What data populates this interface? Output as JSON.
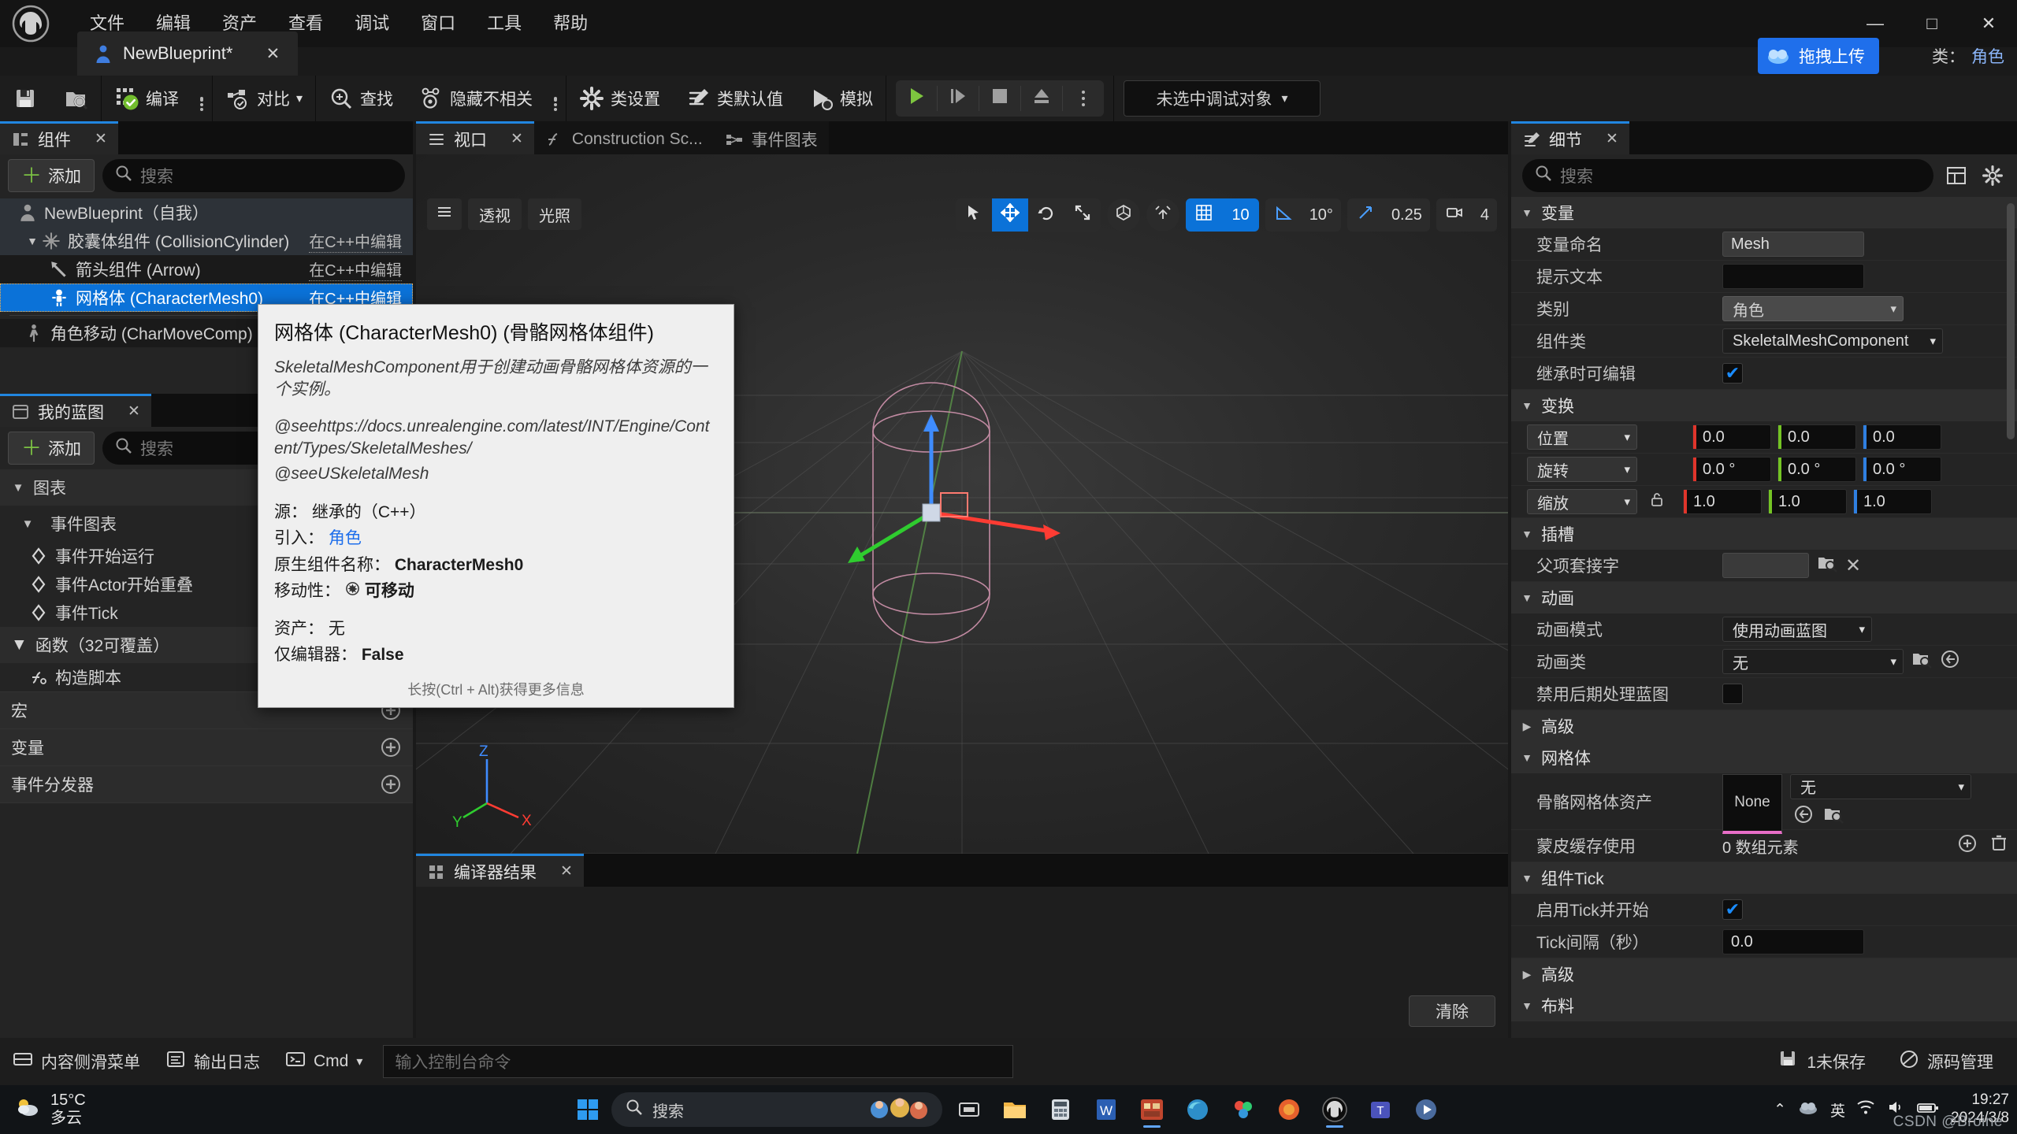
{
  "window": {
    "menu": [
      "文件",
      "编辑",
      "资产",
      "查看",
      "调试",
      "窗口",
      "工具",
      "帮助"
    ],
    "minimize": "—",
    "maximize": "□",
    "close": "✕"
  },
  "doc_tab": {
    "label": "NewBlueprint*",
    "close": "✕",
    "icon": "blueprint-character-icon"
  },
  "upload": {
    "label": "拖拽上传",
    "icon": "cloud-upload-icon"
  },
  "account": {
    "label": "类：",
    "value": "角色"
  },
  "toolbar": {
    "save_icon": "save-icon",
    "browse_icon": "browse-content-icon",
    "compile": "编译",
    "diff": "对比",
    "find": "查找",
    "hide_unrelated": "隐藏不相关",
    "class_settings": "类设置",
    "class_defaults": "类默认值",
    "simulate": "模拟",
    "play": "play-icon",
    "step": "step-icon",
    "stop": "stop-icon",
    "eject": "eject-icon",
    "debug_object": "未选中调试对象"
  },
  "components_panel": {
    "tab_label": "组件",
    "tab_close": "✕",
    "add_label": "添加",
    "search_placeholder": "搜索",
    "edit_in_cpp": "在C++中编辑",
    "tree": [
      {
        "label": "NewBlueprint（自我）",
        "level": 0,
        "cpp": "",
        "selected": false,
        "icon": "character-icon"
      },
      {
        "label": "胶囊体组件 (CollisionCylinder)",
        "level": 1,
        "cpp": "在C++中编辑",
        "selected": false,
        "icon": "capsule-icon"
      },
      {
        "label": "箭头组件 (Arrow)",
        "level": 2,
        "cpp": "在C++中编辑",
        "selected": false,
        "icon": "arrow-icon"
      },
      {
        "label": "网格体 (CharacterMesh0)",
        "level": 2,
        "cpp": "在C++中编辑",
        "selected": true,
        "icon": "skeletal-mesh-icon"
      },
      {
        "label": "角色移动 (CharMoveComp)",
        "level": 1,
        "cpp": "",
        "selected": false,
        "icon": "movement-icon"
      }
    ]
  },
  "blueprint_panel": {
    "tab_label": "我的蓝图",
    "tab_close": "✕",
    "add_label": "添加",
    "search_placeholder": "搜索",
    "sections": [
      {
        "label": "图表",
        "type": "category",
        "caret": "▼"
      },
      {
        "label": "事件图表",
        "type": "subcategory",
        "caret": "▼"
      },
      {
        "label": "事件开始运行",
        "type": "event"
      },
      {
        "label": "事件Actor开始重叠",
        "type": "event"
      },
      {
        "label": "事件Tick",
        "type": "event"
      },
      {
        "label": "函数（32可覆盖）",
        "type": "category",
        "caret": "▼",
        "add": "＋"
      },
      {
        "label": "构造脚本",
        "type": "function"
      },
      {
        "label": "宏",
        "type": "row",
        "add": "＋"
      },
      {
        "label": "变量",
        "type": "row",
        "add": "＋"
      },
      {
        "label": "事件分发器",
        "type": "row",
        "add": "＋"
      }
    ]
  },
  "viewport": {
    "tabs": [
      {
        "label": "视口",
        "active": true,
        "close": "✕",
        "icon": "viewport-icon"
      },
      {
        "label": "Construction Sc...",
        "active": false,
        "icon": "construction-script-icon"
      },
      {
        "label": "事件图表",
        "active": false,
        "icon": "event-graph-icon"
      }
    ],
    "left_tools": [
      "menu-hamburger-icon",
      "透视",
      "光照"
    ],
    "perspective": "透视",
    "lighting": "光照",
    "gizmos": [
      "select-icon",
      "move-icon",
      "rotate-icon",
      "scale-icon"
    ],
    "active_gizmo": "move-icon",
    "coord_icon": "world-coord-icon",
    "snap_icon": "surface-snap-icon",
    "grid_snap_icon": "grid-snap-icon",
    "grid_snap_value": "10",
    "angle_snap_icon": "angle-snap-icon",
    "angle_snap_value": "10°",
    "scale_snap_icon": "scale-snap-icon",
    "scale_snap_value": "0.25",
    "camera_icon": "camera-speed-icon",
    "camera_value": "4",
    "axis_labels": {
      "x": "X",
      "y": "Y",
      "z": "Z"
    }
  },
  "compiler_results": {
    "tab_label": "编译器结果",
    "tab_close": "✕",
    "clear_label": "清除"
  },
  "tooltip": {
    "title": "网格体 (CharacterMesh0) (骨骼网格体组件)",
    "description": "SkeletalMeshComponent用于创建动画骨骼网格体资源的一个实例。",
    "see_lines": [
      "@seehttps://docs.unrealengine.com/latest/INT/Engine/Content/Types/SkeletalMeshes/",
      "@seeUSkeletalMesh"
    ],
    "rows": [
      {
        "key": "源：",
        "value": "继承的（C++）",
        "bold": false
      },
      {
        "key": "引入：",
        "value": "角色",
        "bold": false,
        "link": true
      },
      {
        "key": "原生组件名称：",
        "value": "CharacterMesh0",
        "bold": true
      },
      {
        "key": "移动性：",
        "value": "可移动",
        "bold": true,
        "icon": "movable-icon"
      },
      {
        "key": "资产：",
        "value": "无",
        "bold": false
      },
      {
        "key": "仅编辑器：",
        "value": "False",
        "bold": true
      }
    ],
    "footer": "长按(Ctrl + Alt)获得更多信息"
  },
  "details_panel": {
    "tab_label": "细节",
    "tab_close": "✕",
    "search_placeholder": "搜索",
    "grid_icon": "column-layout-icon",
    "settings_icon": "gear-icon",
    "categories": [
      {
        "label": "变量",
        "caret": "▼",
        "rows": [
          {
            "label": "变量命名",
            "type": "text",
            "value": "Mesh",
            "style": "gray"
          },
          {
            "label": "提示文本",
            "type": "text",
            "value": "",
            "style": "dark"
          },
          {
            "label": "类别",
            "type": "dropdown",
            "value": "角色",
            "style": "gray"
          },
          {
            "label": "组件类",
            "type": "dropdown",
            "value": "SkeletalMeshComponent",
            "style": "dark"
          },
          {
            "label": "继承时可编辑",
            "type": "checkbox",
            "checked": true
          }
        ]
      },
      {
        "label": "变换",
        "caret": "▼",
        "rows": [
          {
            "label": "位置",
            "type": "vector",
            "values": [
              "0.0",
              "0.0",
              "0.0"
            ],
            "dropdown": true
          },
          {
            "label": "旋转",
            "type": "vector",
            "values": [
              "0.0 °",
              "0.0 °",
              "0.0 °"
            ],
            "dropdown": true
          },
          {
            "label": "缩放",
            "type": "vector",
            "values": [
              "1.0",
              "1.0",
              "1.0"
            ],
            "dropdown": true,
            "lock": true
          }
        ]
      },
      {
        "label": "插槽",
        "caret": "▼",
        "rows": [
          {
            "label": "父项套接字",
            "type": "socket",
            "value": ""
          }
        ]
      },
      {
        "label": "动画",
        "caret": "▼",
        "rows": [
          {
            "label": "动画模式",
            "type": "dropdown",
            "value": "使用动画蓝图",
            "style": "dark"
          },
          {
            "label": "动画类",
            "type": "asset-dropdown",
            "value": "无"
          },
          {
            "label": "禁用后期处理蓝图",
            "type": "checkbox",
            "checked": false
          }
        ]
      },
      {
        "label": "高级",
        "caret": "▶",
        "collapsed": true,
        "rows": []
      },
      {
        "label": "网格体",
        "caret": "▼",
        "rows": [
          {
            "label": "骨骼网格体资产",
            "type": "asset-thumb",
            "thumb": "None",
            "value": "无"
          },
          {
            "label": "蒙皮缓存使用",
            "type": "array",
            "value": "0 数组元素"
          }
        ]
      },
      {
        "label": "组件Tick",
        "caret": "▼",
        "rows": [
          {
            "label": "启用Tick并开始",
            "type": "checkbox",
            "checked": true
          },
          {
            "label": "Tick间隔（秒）",
            "type": "text",
            "value": "0.0",
            "style": "dark"
          }
        ]
      },
      {
        "label": "高级",
        "caret": "▶",
        "collapsed": true,
        "rows": []
      },
      {
        "label": "布料",
        "caret": "▼",
        "rows": []
      }
    ]
  },
  "status_bar": {
    "content_drawer": "内容侧滑菜单",
    "output_log": "输出日志",
    "cmd_label": "Cmd",
    "cmd_placeholder": "输入控制台命令",
    "unsaved": "1未保存",
    "source_control": "源码管理"
  },
  "taskbar": {
    "weather_temp": "15°C",
    "weather_desc": "多云",
    "search_placeholder": "搜索",
    "time": "19:27",
    "date": "2024/3/8",
    "lang": "英",
    "apps": [
      "task-view-icon",
      "file-explorer-icon",
      "calculator-icon",
      "word-icon",
      "unreal-project-icon",
      "edge-icon",
      "photos-icon",
      "firefox-icon",
      "unreal-engine-icon",
      "teams-icon",
      "media-player-icon"
    ]
  },
  "watermark": "CSDN @Broine"
}
